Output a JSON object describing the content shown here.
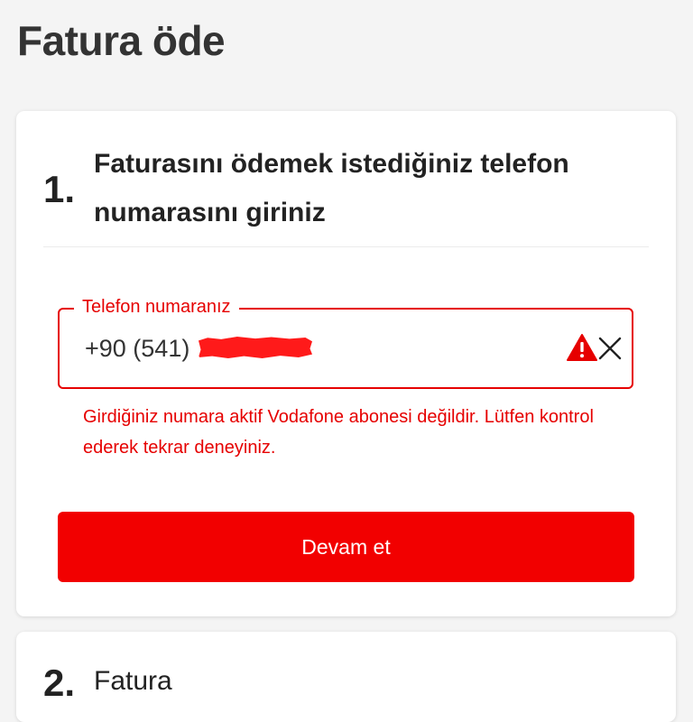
{
  "page": {
    "title": "Fatura öde"
  },
  "step1": {
    "number": "1.",
    "title": "Faturasını ödemek istediğiniz telefon numarasını giriniz",
    "phone_field": {
      "label": "Telefon numaranız",
      "value": "+90 (541)",
      "state": "error"
    },
    "error_message": "Girdiğiniz numara aktif Vodafone abonesi değildir. Lütfen kontrol ederek tekrar deneyiniz.",
    "continue_label": "Devam et"
  },
  "step2": {
    "number": "2.",
    "title": "Fatura"
  },
  "icons": {
    "warning": "warning-icon",
    "clear": "close-icon"
  },
  "colors": {
    "brand_red": "#e60000",
    "button_red": "#f20000",
    "background": "#f4f4f4",
    "card": "#ffffff"
  }
}
